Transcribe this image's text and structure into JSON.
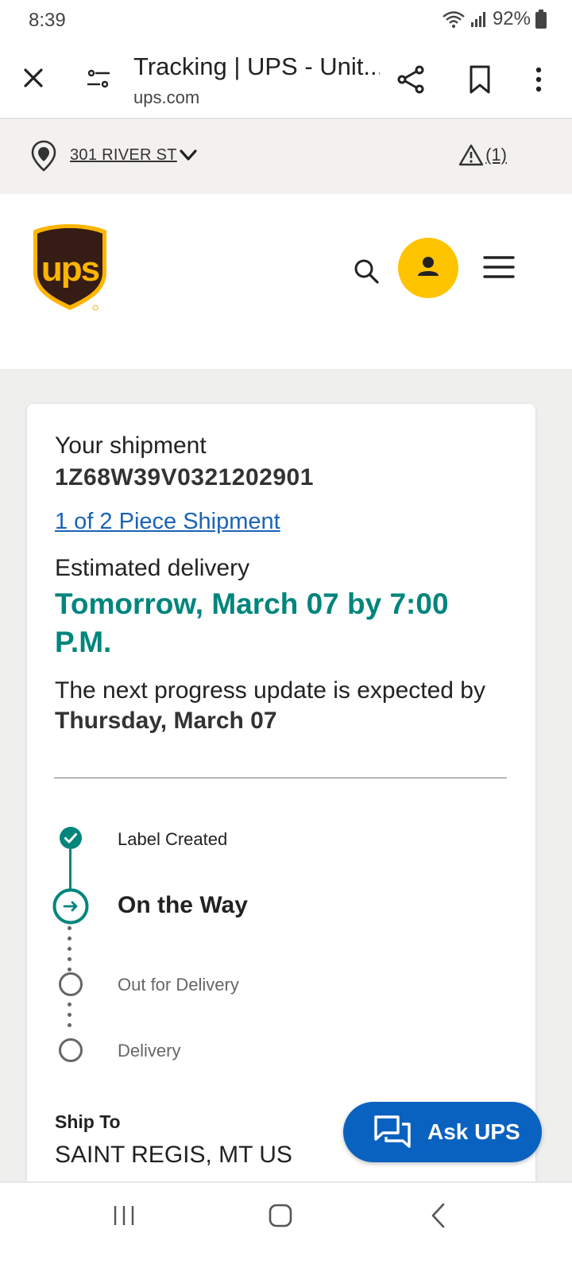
{
  "status_bar": {
    "time": "8:39",
    "battery": "92%"
  },
  "browser": {
    "page_title": "Tracking | UPS - Unit...",
    "url": "ups.com"
  },
  "location_bar": {
    "address": "301 RIVER ST",
    "alert_count": "(1)"
  },
  "brand": {
    "logo_text": "ups",
    "accent": "#ffc400",
    "brown": "#351c15"
  },
  "shipment": {
    "label": "Your shipment",
    "tracking_number": "1Z68W39V0321202901",
    "piece_link": "1 of 2 Piece Shipment",
    "estimated_label": "Estimated delivery",
    "estimated_date": "Tomorrow, March 07 by 7:00 P.M.",
    "next_update_prefix": "The next progress update is expected by ",
    "next_update_date": "Thursday, March 07",
    "accent_color": "#00857d"
  },
  "timeline": [
    {
      "label": "Label Created",
      "state": "done"
    },
    {
      "label": "On the Way",
      "state": "current"
    },
    {
      "label": "Out for Delivery",
      "state": "future"
    },
    {
      "label": "Delivery",
      "state": "future"
    }
  ],
  "ship_to": {
    "label": "Ship To",
    "value": "SAINT REGIS, MT US"
  },
  "ask_ups": {
    "label": "Ask UPS"
  }
}
